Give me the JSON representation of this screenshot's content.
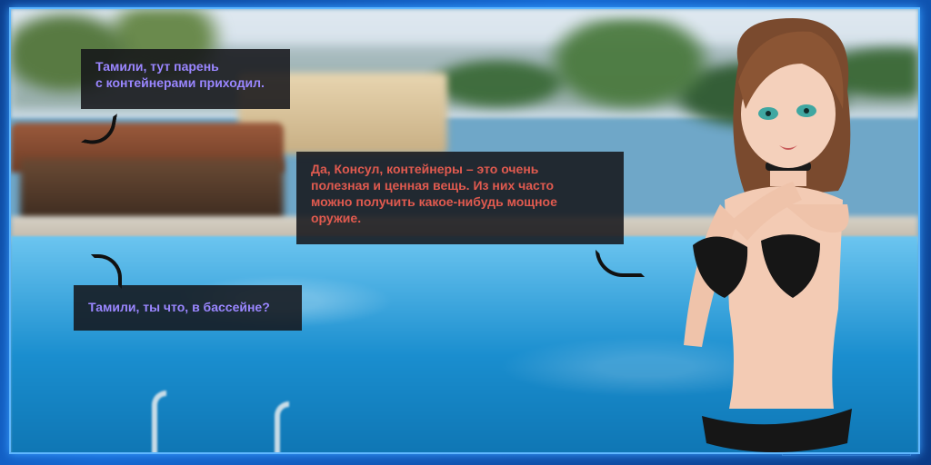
{
  "dialogue": [
    {
      "speaker_color": "#9a86ff",
      "text": "Тамили, тут парень\nс контейнерами приходил."
    },
    {
      "speaker_color": "#e05a4f",
      "text": "Да, Консул, контейнеры – это очень\nполезная и ценная вещь. Из них часто\nможно получить какое-нибудь мощное\nоружие."
    },
    {
      "speaker_color": "#9a86ff",
      "text": "Тамили, ты что, в бассейне?"
    }
  ],
  "colors": {
    "frame_glow": "#5fb7ff",
    "bubble_bg": "#141418"
  }
}
